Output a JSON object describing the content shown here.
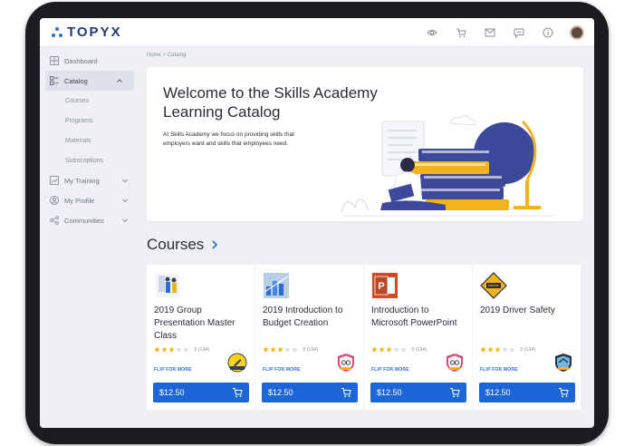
{
  "brand": {
    "logo_text": "TOPYX",
    "accent": "#1e66d8"
  },
  "topbar": {
    "icons": [
      "eye-icon",
      "cart-icon",
      "mail-icon",
      "chat-icon",
      "info-icon",
      "user-avatar"
    ]
  },
  "sidebar": {
    "items": [
      {
        "label": "Dashboard",
        "icon": "grid-icon"
      },
      {
        "label": "Catalog",
        "icon": "catalog-icon",
        "expanded": true,
        "sub": [
          "Courses",
          "Programs",
          "Materials",
          "Subscriptions"
        ]
      },
      {
        "label": "My Training",
        "icon": "chart-icon"
      },
      {
        "label": "My Profile",
        "icon": "profile-icon"
      },
      {
        "label": "Communities",
        "icon": "communities-icon"
      }
    ]
  },
  "breadcrumb": "Home > Catalog",
  "hero": {
    "title": "Welcome to the Skills Academy Learning Catalog",
    "text": "At Skills Academy we focus on providing skills that employers want and skills that employees need."
  },
  "courses": {
    "section_title": "Courses",
    "items": [
      {
        "title": "2019 Group Presentation Master Class",
        "stars": 3,
        "reviews": "3 (134)",
        "flip": "FLIP FOR MORE",
        "price": "$12.50",
        "badge": "yellow"
      },
      {
        "title": "2019 Introduction to Budget Creation",
        "stars": 3,
        "reviews": "3 (134)",
        "flip": "FLIP FOR MORE",
        "price": "$12.50",
        "badge": "pink"
      },
      {
        "title": "Introduction to Microsoft PowerPoint",
        "stars": 3,
        "reviews": "3 (134)",
        "flip": "FLIP FOR MORE",
        "price": "$12.50",
        "badge": "pink"
      },
      {
        "title": "2019 Driver Safety",
        "stars": 3,
        "reviews": "3 (134)",
        "flip": "FLIP FOR MORE",
        "price": "$12.50",
        "badge": "blue"
      }
    ]
  }
}
